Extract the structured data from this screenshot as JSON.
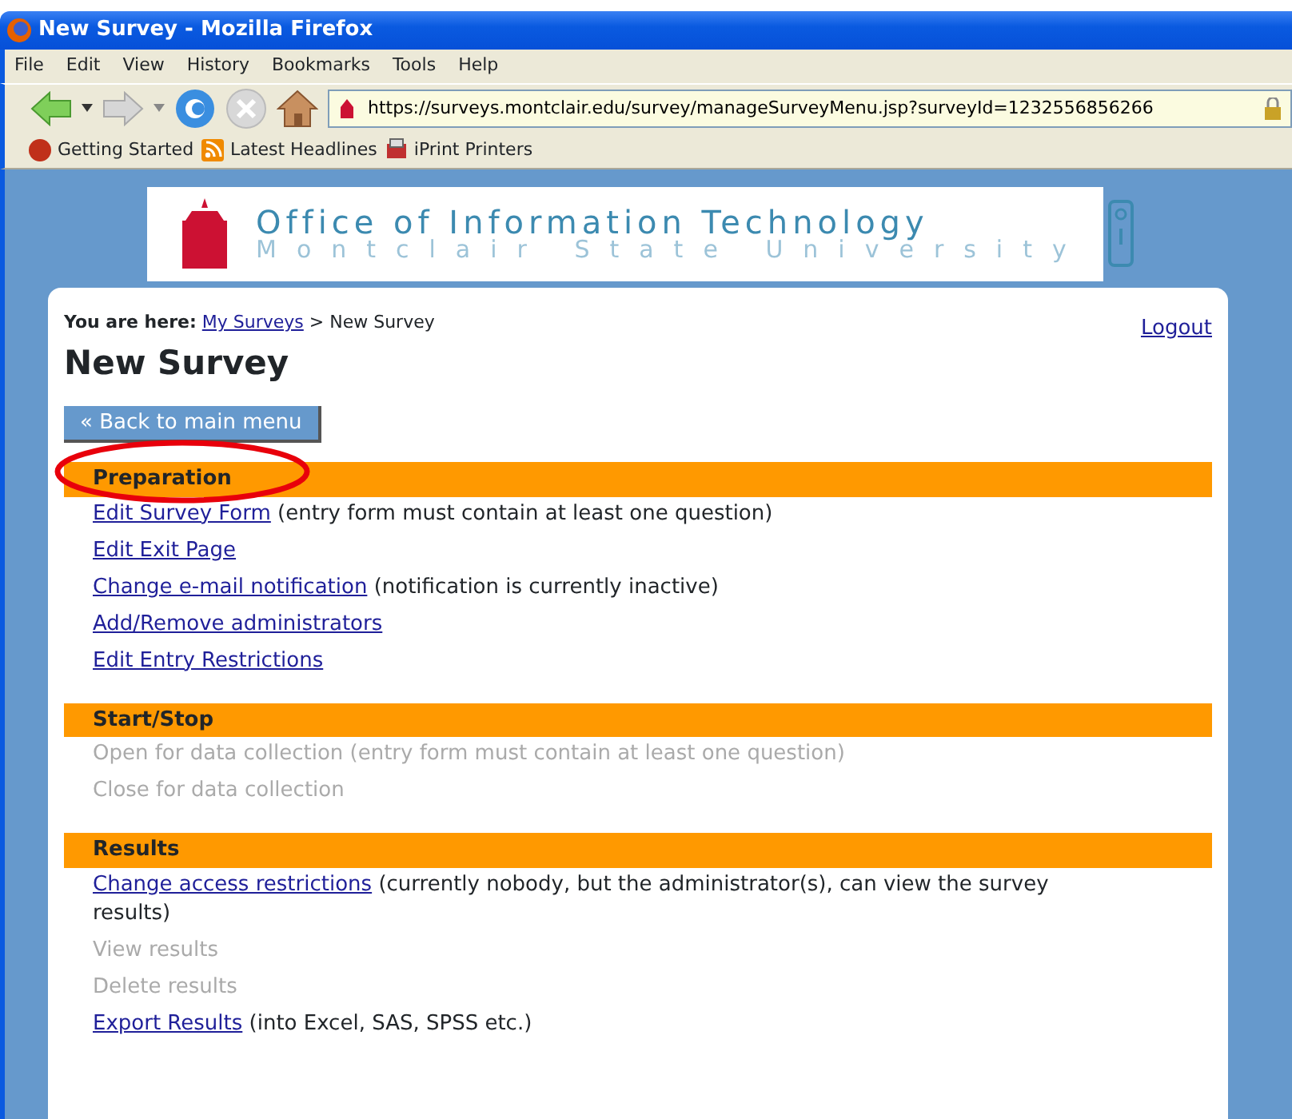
{
  "window": {
    "title": "New Survey - Mozilla Firefox"
  },
  "menu": [
    "File",
    "Edit",
    "View",
    "History",
    "Bookmarks",
    "Tools",
    "Help"
  ],
  "address": {
    "value": "https://surveys.montclair.edu/survey/manageSurveyMenu.jsp?surveyId=1232556856266"
  },
  "bookmarks": [
    "Getting Started",
    "Latest Headlines",
    "iPrint Printers"
  ],
  "banner": {
    "title": "Office of Information Technology",
    "subtitle": "Montclair State University"
  },
  "breadcrumb": {
    "label": "You are here:",
    "link": "My Surveys",
    "separator": ">",
    "current": "New Survey"
  },
  "logout": "Logout",
  "heading": "New Survey",
  "back_button": "« Back to main menu",
  "sections": [
    {
      "title": "Preparation",
      "highlighted": true,
      "items": [
        {
          "label": "Edit Survey Form",
          "note": "(entry form must contain at least one question)",
          "disabled": false
        },
        {
          "label": "Edit Exit Page",
          "disabled": false
        },
        {
          "label": "Change e-mail notification",
          "note": "(notification is currently inactive)",
          "disabled": false
        },
        {
          "label": "Add/Remove administrators",
          "disabled": false
        },
        {
          "label": "Edit Entry Restrictions",
          "disabled": false
        }
      ]
    },
    {
      "title": "Start/Stop",
      "highlighted": false,
      "items": [
        {
          "label": "Open for data collection (entry form must contain at least one question)",
          "disabled": true
        },
        {
          "label": "Close for data collection",
          "disabled": true
        }
      ]
    },
    {
      "title": "Results",
      "highlighted": false,
      "items": [
        {
          "label": "Change access restrictions",
          "note": "(currently nobody, but the administrator(s), can view the survey results)",
          "disabled": false
        },
        {
          "label": "View results",
          "disabled": true
        },
        {
          "label": "Delete results",
          "disabled": true
        },
        {
          "label": "Export Results",
          "note": "(into Excel, SAS, SPSS etc.)",
          "disabled": false
        }
      ]
    }
  ]
}
